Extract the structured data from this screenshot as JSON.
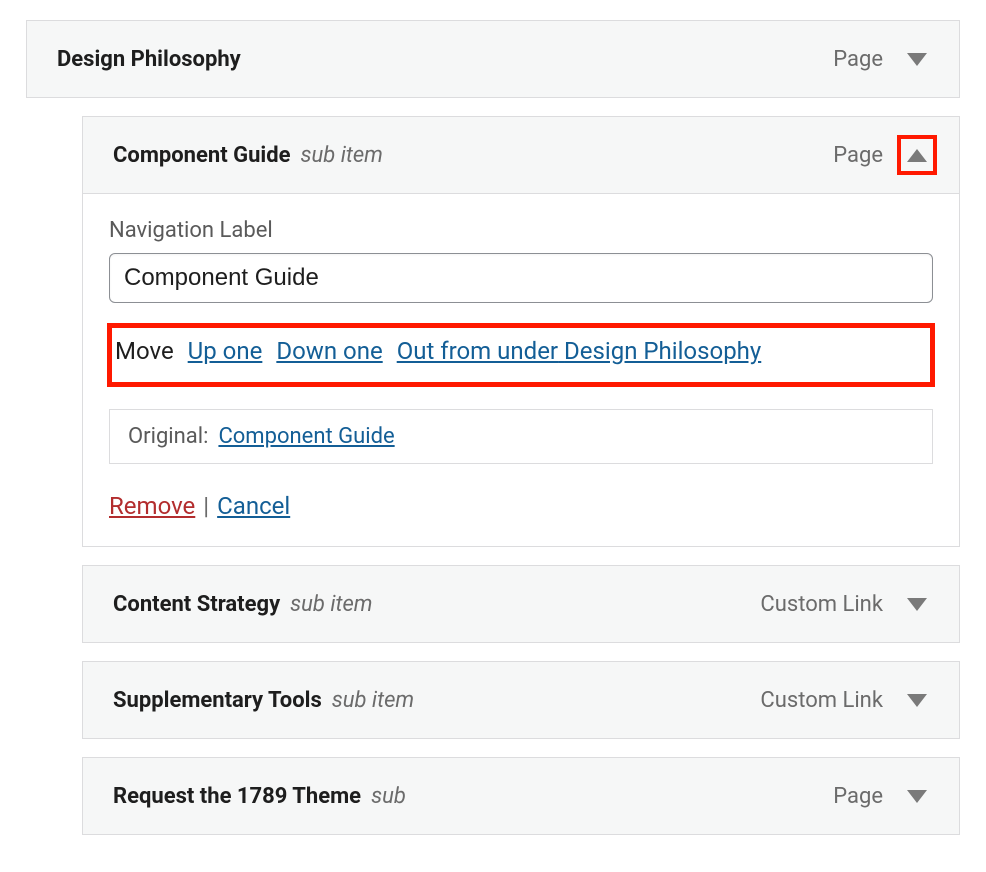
{
  "labels": {
    "sub_item": "sub item",
    "sub": "sub",
    "nav_label": "Navigation Label",
    "move": "Move",
    "up_one": "Up one",
    "down_one": "Down one",
    "out_from_under_prefix": "Out from under",
    "original": "Original:",
    "remove": "Remove",
    "cancel": "Cancel",
    "pipe": "|"
  },
  "types": {
    "page": "Page",
    "custom_link": "Custom Link"
  },
  "items": [
    {
      "title": "Design Philosophy",
      "type_key": "page",
      "child": false,
      "expanded": false,
      "sub_label": ""
    },
    {
      "title": "Component Guide",
      "type_key": "page",
      "child": true,
      "expanded": true,
      "sub_label": "sub item",
      "settings": {
        "nav_label_value": "Component Guide",
        "parent_title": "Design Philosophy",
        "original_title": "Component Guide"
      }
    },
    {
      "title": "Content Strategy",
      "type_key": "custom_link",
      "child": true,
      "expanded": false,
      "sub_label": "sub item"
    },
    {
      "title": "Supplementary Tools",
      "type_key": "custom_link",
      "child": true,
      "expanded": false,
      "sub_label": "sub item"
    },
    {
      "title": "Request the 1789 Theme",
      "type_key": "page",
      "child": true,
      "expanded": false,
      "sub_label": "sub"
    }
  ],
  "highlights": {
    "toggle_highlight_on_expanded": true,
    "move_row_highlight": true
  }
}
